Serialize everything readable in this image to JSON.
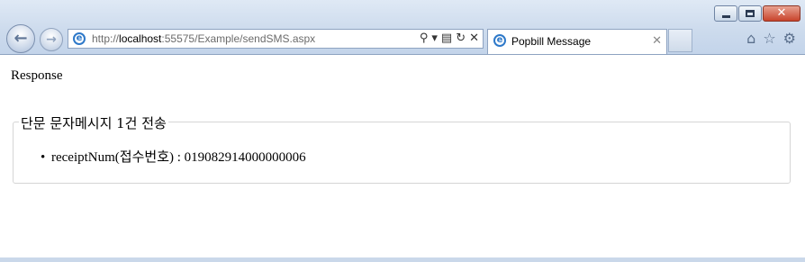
{
  "browser": {
    "address_url_path": "http://localhost:55575/Example/sendSMS.aspx",
    "tab_title": "Popbill Message",
    "ie_glyph": "e",
    "back_glyph": "←",
    "forward_glyph": "→",
    "tools": {
      "search": "⚲",
      "dropdown": "▾",
      "compat": "▤",
      "refresh": "↻",
      "stop": "✕"
    },
    "tab_close_glyph": "✕",
    "right_icons": {
      "home": "⌂",
      "favorites": "☆",
      "settings": "⚙"
    },
    "window_controls": {
      "minimize": "",
      "maximize": "",
      "close": "✕"
    }
  },
  "page": {
    "heading": "Response",
    "fieldset_legend": "단문 문자메시지 1건 전송",
    "items": [
      {
        "bullet": "•",
        "label": "receiptNum(접수번호) : 019082914000000006"
      }
    ]
  }
}
